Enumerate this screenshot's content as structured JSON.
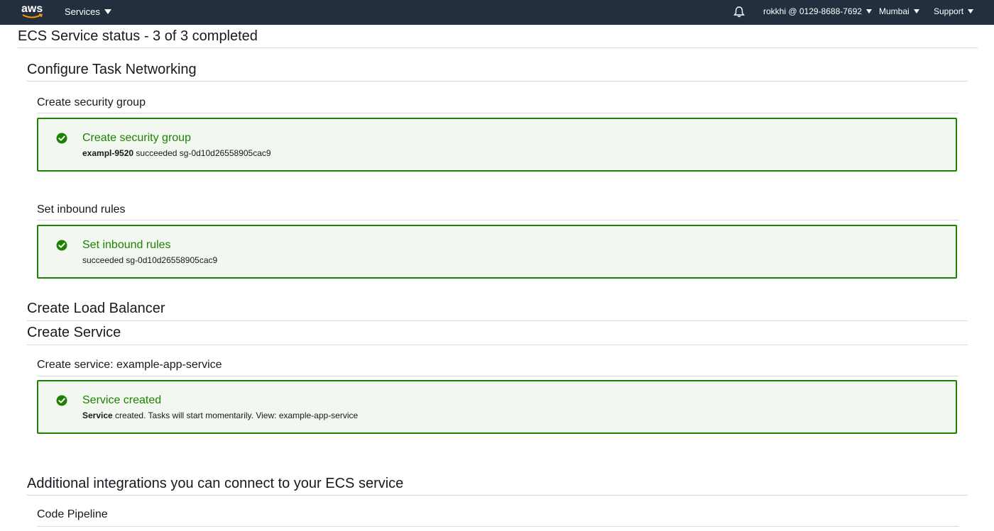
{
  "nav": {
    "logo": "aws",
    "services_label": "Services",
    "account_label": "rokkhi @ 0129-8688-7692",
    "region_label": "Mumbai",
    "support_label": "Support",
    "icons": {
      "notifications": "bell-icon",
      "dropdown": "caret-down-icon"
    }
  },
  "page": {
    "title": "ECS Service status - 3 of 3 completed"
  },
  "sections": {
    "task_networking": {
      "title": "Configure Task Networking",
      "security_group": {
        "subtitle": "Create security group",
        "alert_title": "Create security group",
        "msg_name": "exampl-9520",
        "msg_status": "succeeded",
        "msg_id": "sg-0d10d26558905cac9"
      },
      "inbound_rules": {
        "subtitle": "Set inbound rules",
        "alert_title": "Set inbound rules",
        "msg_status": "succeeded",
        "msg_id": "sg-0d10d26558905cac9"
      }
    },
    "load_balancer": {
      "title": "Create Load Balancer"
    },
    "create_service": {
      "title": "Create Service",
      "subtitle": "Create service: example-app-service",
      "alert_title": "Service created",
      "msg_bold": "Service",
      "msg_text": "created. Tasks will start momentarily. View:",
      "msg_link": "example-app-service"
    },
    "integrations": {
      "title": "Additional integrations you can connect to your ECS service",
      "code_pipeline": "Code Pipeline"
    }
  },
  "colors": {
    "nav_bg": "#232f3e",
    "success": "#1d8102",
    "success_bg": "#f2f8f0",
    "divider": "#d5dbdb"
  }
}
